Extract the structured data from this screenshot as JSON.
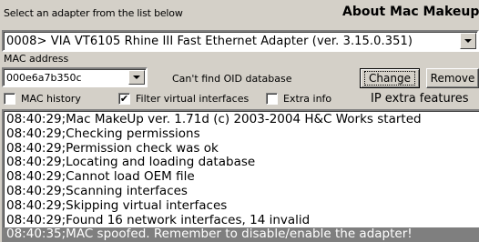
{
  "header": {
    "select_label": "Select an adapter from the list below",
    "about_title": "About Mac Makeup"
  },
  "adapter": {
    "selected": "0008> VIA VT6105 Rhine III Fast Ethernet Adapter (ver. 3.15.0.351)"
  },
  "mac": {
    "label": "MAC address",
    "value": "000e6a7b350c",
    "oid_note": "Can't find OID database"
  },
  "buttons": {
    "change": "Change",
    "remove": "Remove"
  },
  "options": {
    "mac_history": {
      "label": "MAC history",
      "checked": false
    },
    "filter_virtual": {
      "label": "Filter virtual interfaces",
      "checked": true
    },
    "extra_info": {
      "label": "Extra info",
      "checked": false
    },
    "ip_extra": "IP extra features"
  },
  "log": {
    "lines": [
      "08:40:29;Mac MakeUp ver. 1.71d (c) 2003-2004 H&C Works started",
      "08:40:29;Checking permissions",
      "08:40:29;Permission check was ok",
      "08:40:29;Locating and loading database",
      "08:40:29;Cannot load OEM file",
      "08:40:29;Scanning interfaces",
      "08:40:29;Skipping virtual interfaces",
      "08:40:29;Found 16 network interfaces, 14 invalid",
      "08:40:35;MAC spoofed. Remember to disable/enable the adapter!"
    ],
    "selected_index": 8
  }
}
